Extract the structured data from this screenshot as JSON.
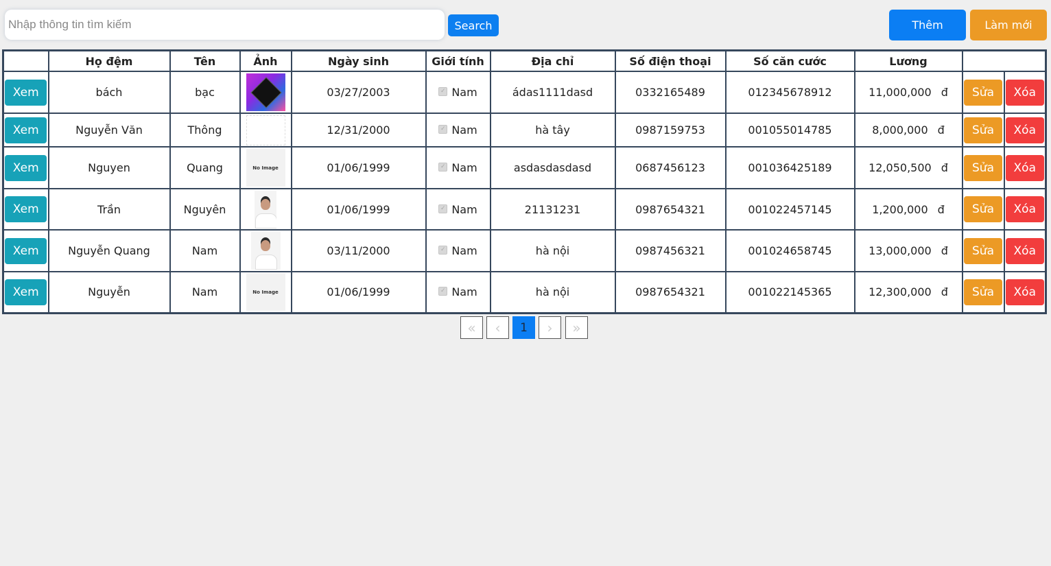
{
  "search": {
    "placeholder": "Nhập thông tin tìm kiếm",
    "button_label": "Search"
  },
  "actions": {
    "add_label": "Thêm",
    "refresh_label": "Làm mới"
  },
  "table": {
    "columns": [
      "",
      "Họ đệm",
      "Tên",
      "Ảnh",
      "Ngày sinh",
      "Giới tính",
      "Địa chỉ",
      "Số điện thoại",
      "Số căn cước",
      "Lương",
      ""
    ],
    "row_buttons": {
      "view": "Xem",
      "edit": "Sửa",
      "delete": "Xóa"
    },
    "currency": "đ",
    "rows": [
      {
        "ho_dem": "bách",
        "ten": "bạc",
        "photo": "art",
        "ngay_sinh": "03/27/2003",
        "gioi_tinh": "Nam",
        "dia_chi": "ádas1111dasd",
        "sdt": "0332165489",
        "cccd": "012345678912",
        "luong": "11,000,000"
      },
      {
        "ho_dem": "Nguyễn Văn",
        "ten": "Thông",
        "photo": "sketch",
        "ngay_sinh": "12/31/2000",
        "gioi_tinh": "Nam",
        "dia_chi": "hà tây",
        "sdt": "0987159753",
        "cccd": "001055014785",
        "luong": "8,000,000"
      },
      {
        "ho_dem": "Nguyen",
        "ten": "Quang",
        "photo": "no-image",
        "photo_text": "No Image",
        "ngay_sinh": "01/06/1999",
        "gioi_tinh": "Nam",
        "dia_chi": "asdasdasdasd",
        "sdt": "0687456123",
        "cccd": "001036425189",
        "luong": "12,050,500"
      },
      {
        "ho_dem": "Trần",
        "ten": "Nguyên",
        "photo": "person",
        "ngay_sinh": "01/06/1999",
        "gioi_tinh": "Nam",
        "dia_chi": "21131231",
        "sdt": "0987654321",
        "cccd": "001022457145",
        "luong": "1,200,000"
      },
      {
        "ho_dem": "Nguyễn Quang",
        "ten": "Nam",
        "photo": "person-wide",
        "ngay_sinh": "03/11/2000",
        "gioi_tinh": "Nam",
        "dia_chi": "hà nội",
        "sdt": "0987456321",
        "cccd": "001024658745",
        "luong": "13,000,000"
      },
      {
        "ho_dem": "Nguyễn",
        "ten": "Nam",
        "photo": "no-image",
        "photo_text": "No Image",
        "ngay_sinh": "01/06/1999",
        "gioi_tinh": "Nam",
        "dia_chi": "hà nội",
        "sdt": "0987654321",
        "cccd": "001022145365",
        "luong": "12,300,000"
      }
    ]
  },
  "pagination": {
    "first": "«",
    "prev": "‹",
    "current": "1",
    "next": "›",
    "last": "»"
  },
  "colors": {
    "primary": "#0b7ef3",
    "info": "#17a2b8",
    "warning": "#ec9a25",
    "danger": "#f23d3d",
    "border": "#36475c"
  }
}
